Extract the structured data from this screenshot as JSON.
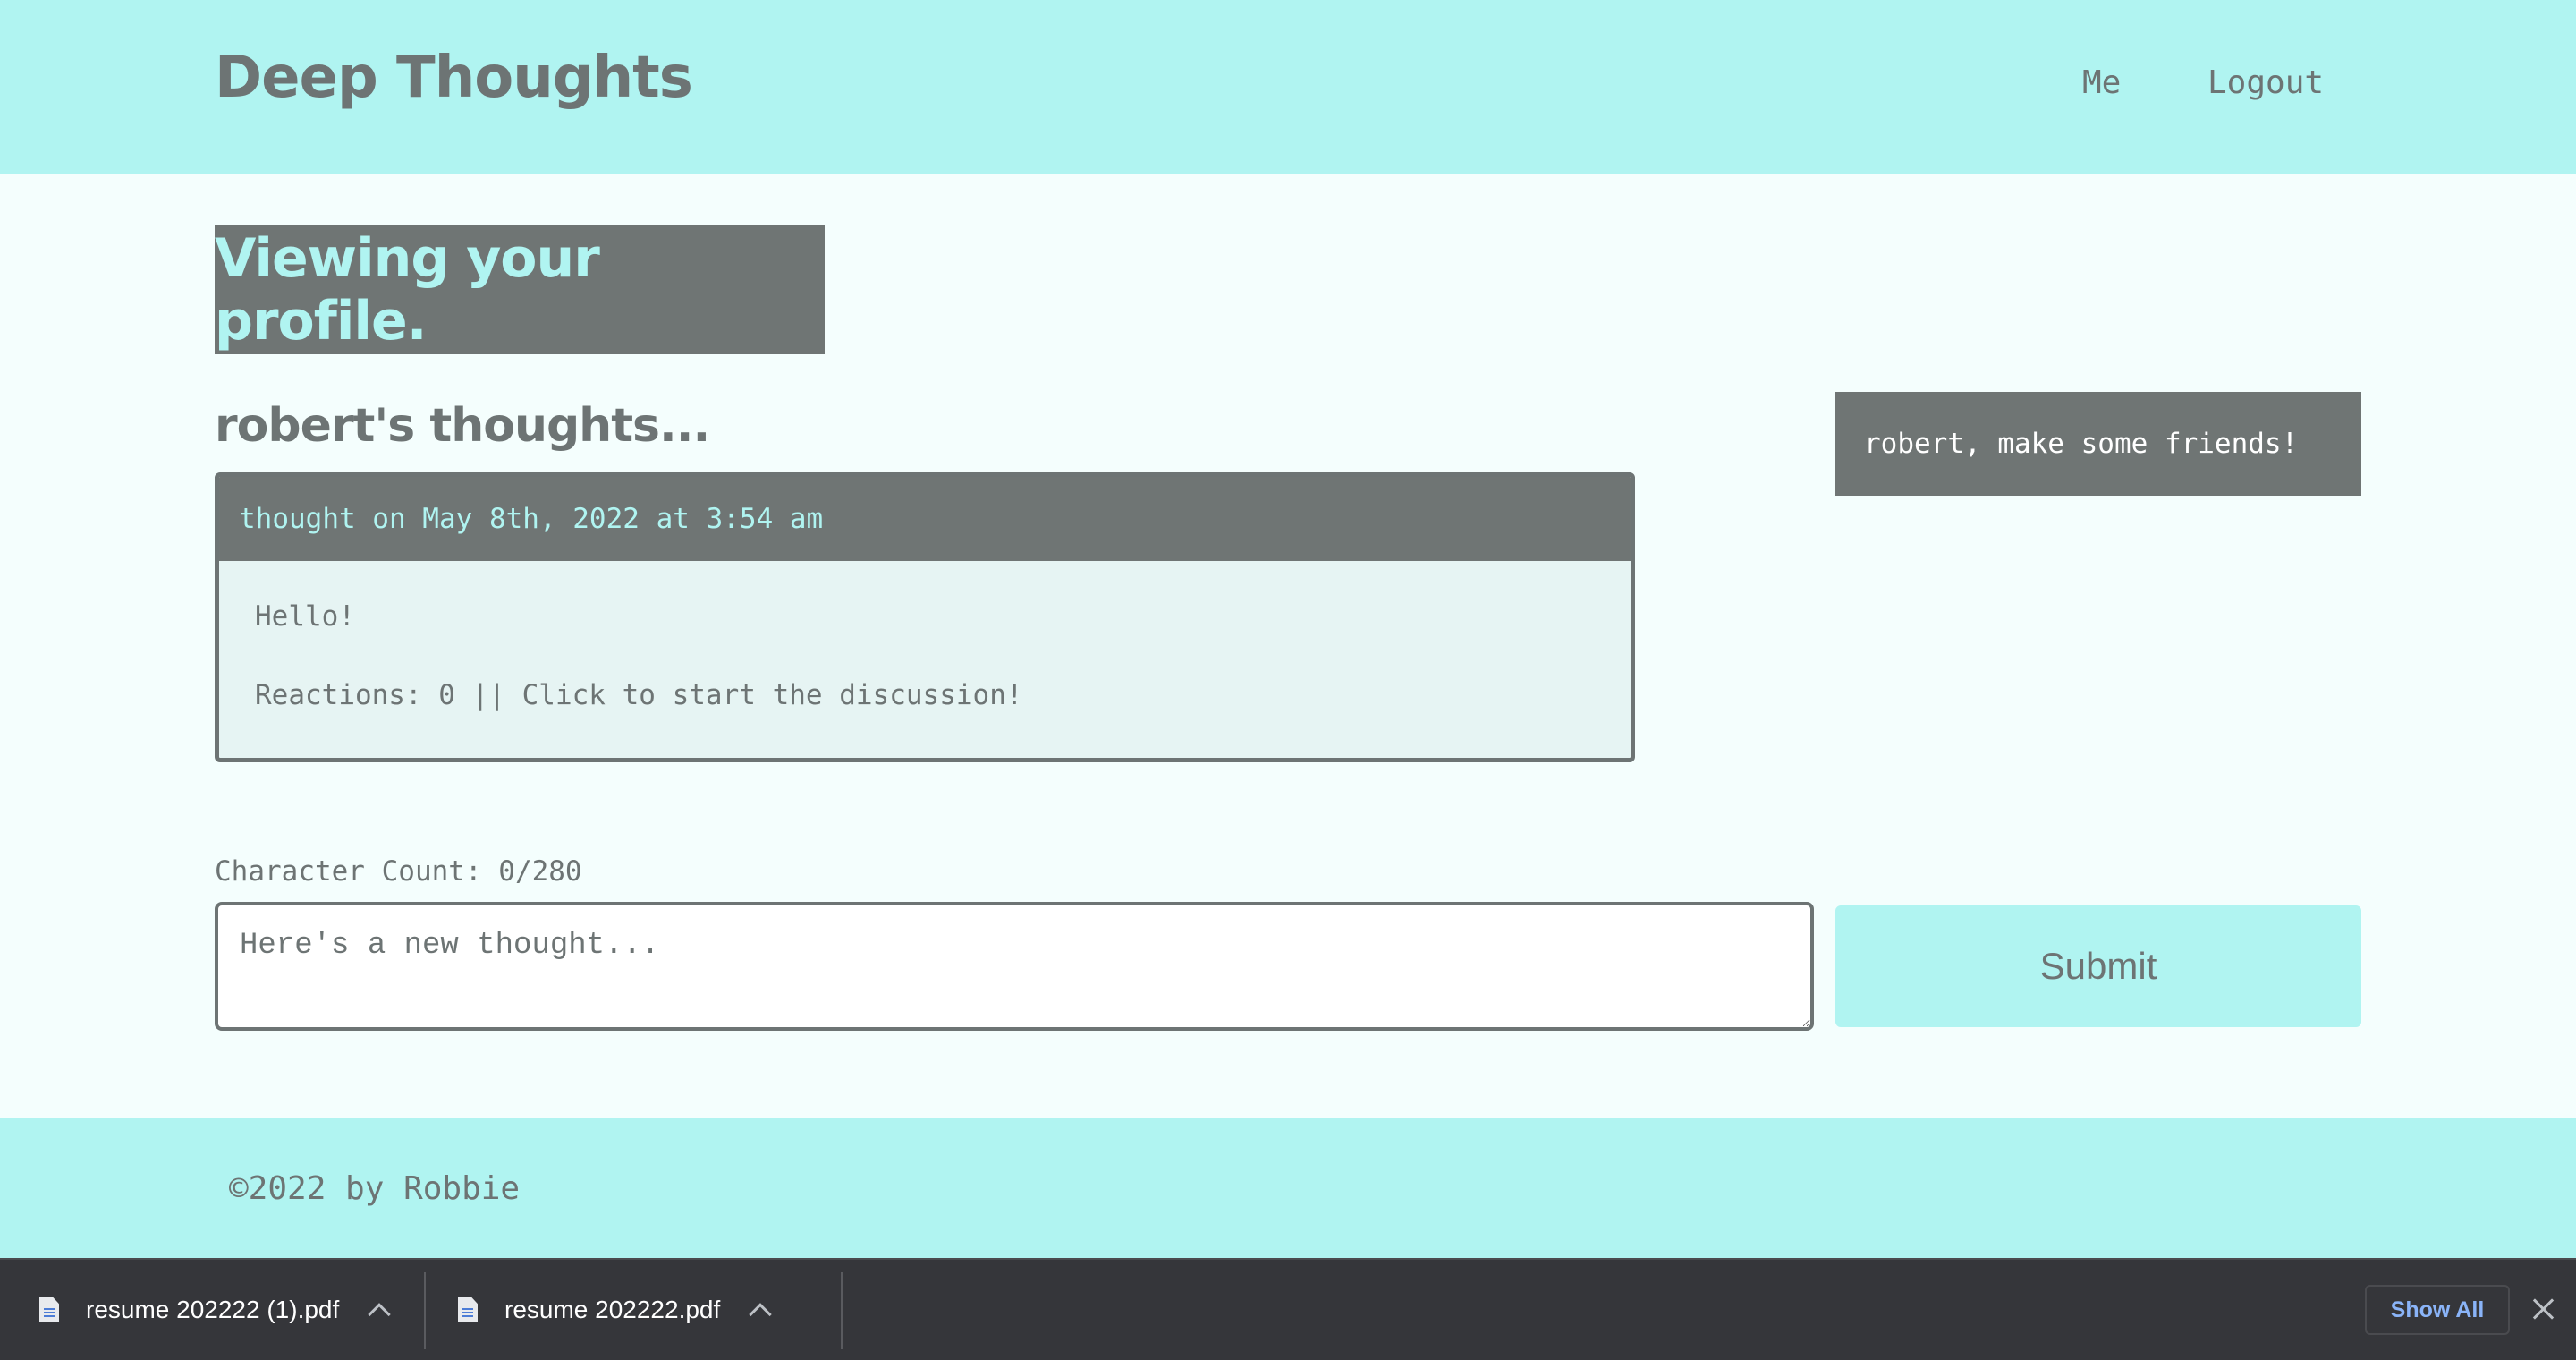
{
  "header": {
    "brand": "Deep Thoughts",
    "nav": {
      "me": "Me",
      "logout": "Logout"
    }
  },
  "profile": {
    "banner": "Viewing your profile.",
    "thoughts_heading": "robert's thoughts...",
    "friends_message": "robert, make some friends!"
  },
  "thoughts": [
    {
      "header": "thought on May 8th, 2022 at 3:54 am",
      "text": "Hello!",
      "reactions": "Reactions: 0 || Click to start the discussion!"
    }
  ],
  "form": {
    "char_count": "Character Count: 0/280",
    "placeholder": "Here's a new thought...",
    "value": "",
    "submit_label": "Submit"
  },
  "footer": {
    "text": "©2022 by Robbie"
  },
  "downloads": {
    "items": [
      {
        "name": "resume 202222 (1).pdf",
        "icon": "pdf-file-icon"
      },
      {
        "name": "resume 202222.pdf",
        "icon": "pdf-file-icon"
      }
    ],
    "show_all_label": "Show All"
  },
  "colors": {
    "accent": "#b0f4f1",
    "dark_gray": "#6f7574",
    "text_gray": "#6d7474",
    "page_bg": "#f4fefd",
    "download_bar": "#35363a",
    "link_blue": "#8ab4f8"
  }
}
